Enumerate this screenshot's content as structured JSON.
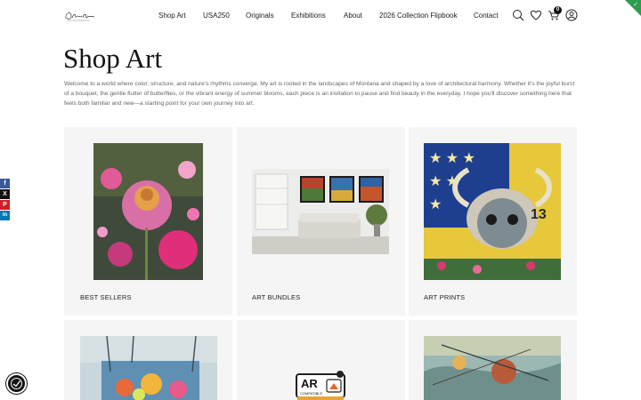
{
  "header": {
    "logo_alt": "Artist signature logo",
    "nav": [
      {
        "label": "Shop Art"
      },
      {
        "label": "USA250"
      },
      {
        "label": "Originals"
      },
      {
        "label": "Exhibitions"
      },
      {
        "label": "About"
      },
      {
        "label": "2026 Collection Flipbook"
      },
      {
        "label": "Contact"
      }
    ],
    "icons": [
      "search-icon",
      "heart-icon",
      "cart-icon",
      "account-icon"
    ],
    "cart_count": "0"
  },
  "page": {
    "title": "Shop Art",
    "intro": "Welcome to a world where color, structure, and nature's rhythms converge. My art is rooted in the landscapes of Montana and shaped by a love of architectural harmony. Whether it's the joyful burst of a bouquet, the gentle flutter of butterflies, or the vibrant energy of summer blooms, each piece is an invitation to pause and find beauty in the everyday. I hope you'll discover something here that feels both familiar and new—a starting point for your own journey into art."
  },
  "social": [
    {
      "name": "facebook",
      "glyph": "f",
      "color": "#3b5998"
    },
    {
      "name": "x",
      "glyph": "X",
      "color": "#111111"
    },
    {
      "name": "pinterest",
      "glyph": "P",
      "color": "#cb2027"
    },
    {
      "name": "linkedin",
      "glyph": "in",
      "color": "#0077b5"
    }
  ],
  "categories": [
    {
      "label": "BEST SELLERS"
    },
    {
      "label": "ART BUNDLES"
    },
    {
      "label": "ART PRINTS"
    },
    {
      "label": ""
    },
    {
      "label": ""
    },
    {
      "label": ""
    }
  ],
  "ar_badge": {
    "text": "AR",
    "subtext": "COMPATIBLE"
  }
}
